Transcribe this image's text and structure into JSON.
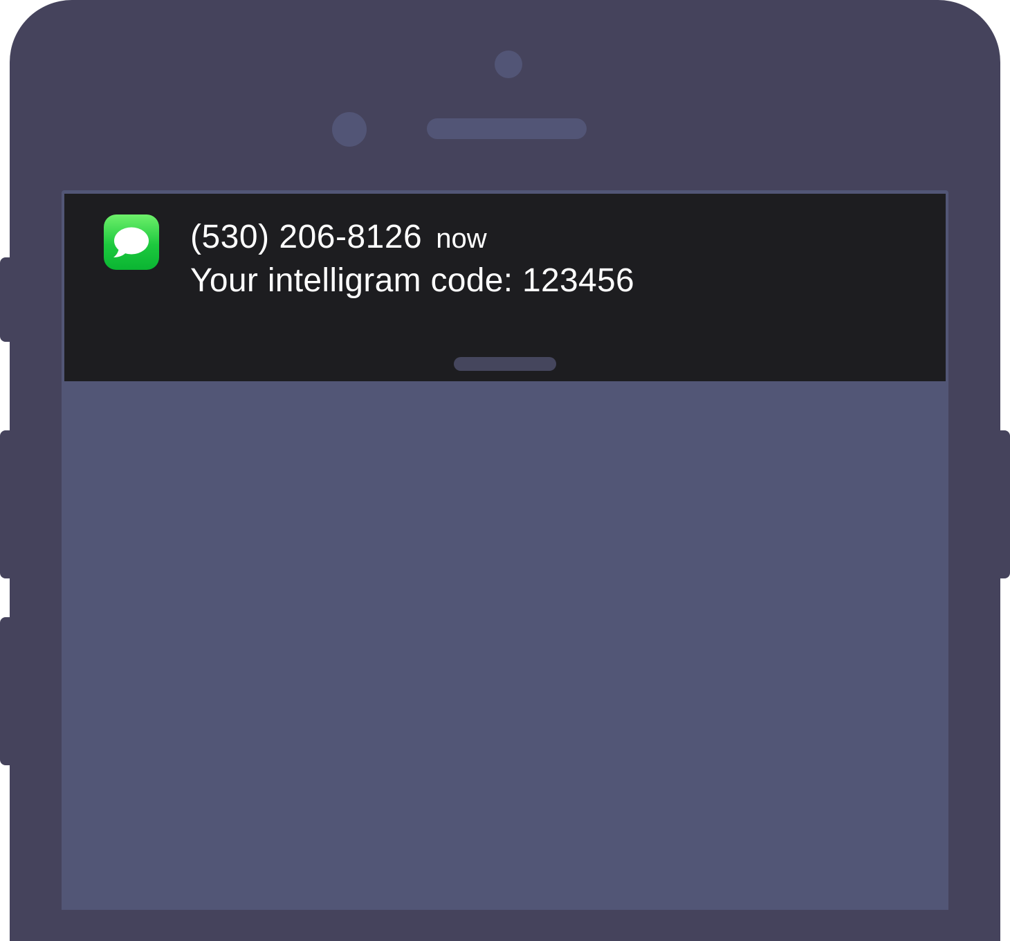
{
  "notification": {
    "app_icon": "messages-bubble-icon",
    "sender": "(530) 206-8126",
    "time": "now",
    "message": "Your intelligram code: 123456"
  },
  "colors": {
    "phone_frame": "#45435c",
    "screen": "#525676",
    "notification_bg": "#1d1d20",
    "app_icon_green": "#1dc93e",
    "text": "#ffffff"
  }
}
